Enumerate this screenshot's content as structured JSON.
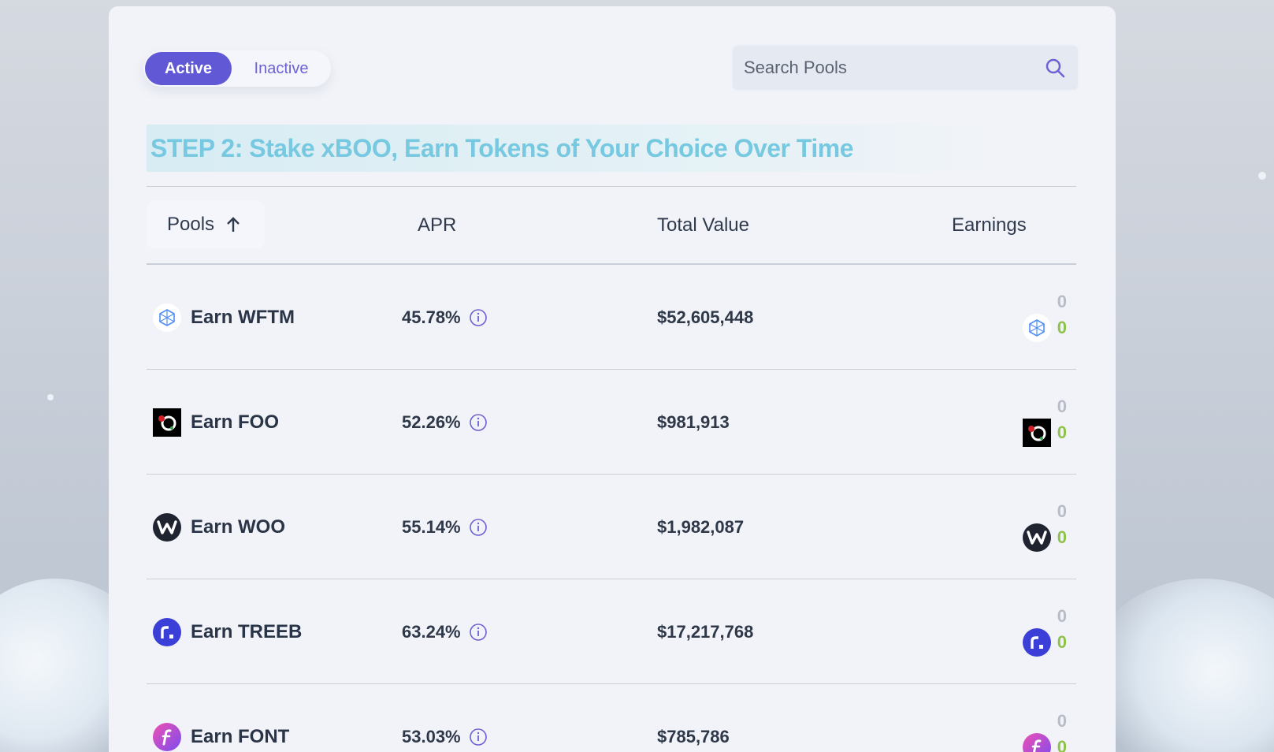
{
  "tabs": {
    "active_label": "Active",
    "inactive_label": "Inactive"
  },
  "search": {
    "placeholder": "Search Pools"
  },
  "step_title": "STEP 2: Stake xBOO, Earn Tokens of Your Choice Over Time",
  "table": {
    "headers": {
      "pools": "Pools",
      "apr": "APR",
      "total_value": "Total Value",
      "earnings": "Earnings"
    },
    "rows": [
      {
        "name": "Earn WFTM",
        "apr": "45.78%",
        "total_value": "$52,605,448",
        "earned_top": "0",
        "earned_bottom": "0",
        "icon": "wftm-icon"
      },
      {
        "name": "Earn FOO",
        "apr": "52.26%",
        "total_value": "$981,913",
        "earned_top": "0",
        "earned_bottom": "0",
        "icon": "foo-icon"
      },
      {
        "name": "Earn WOO",
        "apr": "55.14%",
        "total_value": "$1,982,087",
        "earned_top": "0",
        "earned_bottom": "0",
        "icon": "woo-icon"
      },
      {
        "name": "Earn TREEB",
        "apr": "63.24%",
        "total_value": "$17,217,768",
        "earned_top": "0",
        "earned_bottom": "0",
        "icon": "treeb-icon"
      },
      {
        "name": "Earn FONT",
        "apr": "53.03%",
        "total_value": "$785,786",
        "earned_top": "0",
        "earned_bottom": "0",
        "icon": "font-icon"
      }
    ]
  },
  "colors": {
    "accent": "#6158d6",
    "title": "#76c9e0",
    "earn_green": "#8ec24a",
    "earn_grey": "#b7bcc6"
  }
}
